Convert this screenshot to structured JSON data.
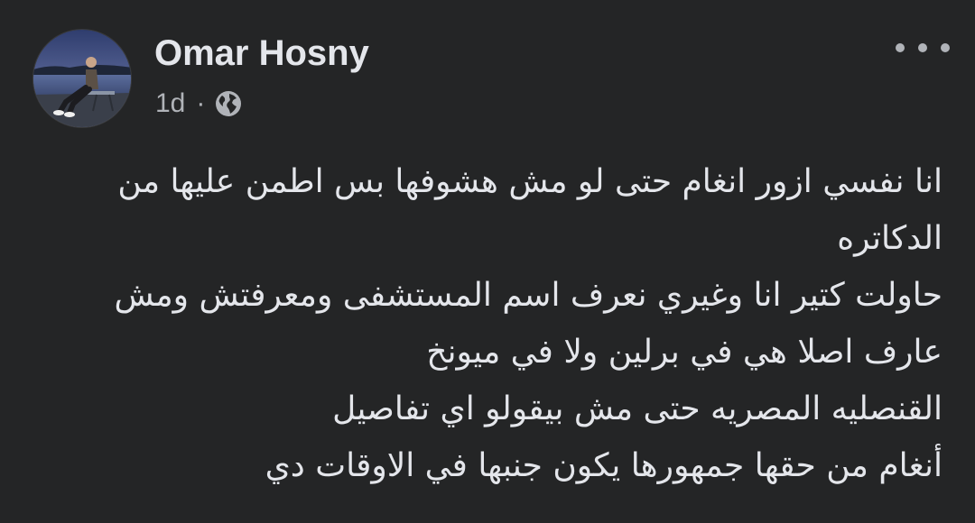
{
  "post": {
    "author_name": "Omar Hosny",
    "time_ago": "1d",
    "separator": "·",
    "audience_icon": "globe-icon",
    "more_icon": "more-options-icon",
    "paragraphs": [
      "انا نفسي ازور انغام حتى لو مش هشوفها بس اطمن عليها من الدكاتره",
      "حاولت كتير انا وغيري نعرف اسم المستشفى ومعرفتش ومش عارف اصلا هي في برلين ولا في ميونخ",
      "القنصليه المصريه حتى مش بيقولو اي تفاصيل",
      "أنغام من حقها جمهورها يكون جنبها في الاوقات دي"
    ]
  },
  "colors": {
    "background": "#242526",
    "text_primary": "#e4e6eb",
    "text_secondary": "#b0b3b8"
  }
}
